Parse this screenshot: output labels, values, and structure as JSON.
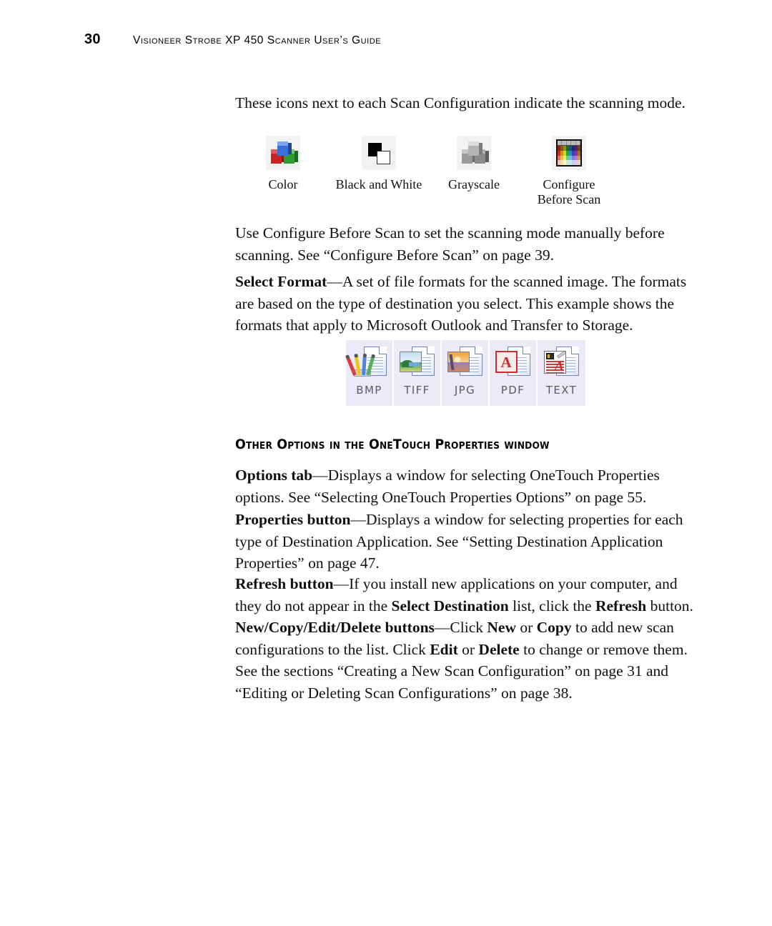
{
  "header": {
    "page_number": "30",
    "title": "Visioneer Strobe XP 450 Scanner User’s Guide"
  },
  "body": {
    "intro_paragraph": "These icons next to each Scan Configuration indicate the scanning mode.",
    "configure_paragraph": "Use Configure Before Scan to set the scanning mode manually before scanning. See “Configure Before Scan” on page 39."
  },
  "scan_modes": [
    {
      "icon": "color-cubes-icon",
      "label": "Color"
    },
    {
      "icon": "black-and-white-squares-icon",
      "label": "Black and White"
    },
    {
      "icon": "grayscale-cubes-icon",
      "label": "Grayscale"
    },
    {
      "icon": "color-palette-icon",
      "label": "Configure\nBefore Scan"
    }
  ],
  "select_format": {
    "bold_lead": "Select Format",
    "rest": "—A set of file formats for the scanned image. The formats are based on the type of destination you select. This example shows the formats that apply to Microsoft Outlook and Transfer to Storage."
  },
  "file_formats": [
    {
      "icon": "bmp-file-icon",
      "label": "BMP"
    },
    {
      "icon": "tiff-file-icon",
      "label": "TIFF"
    },
    {
      "icon": "jpg-file-icon",
      "label": "JPG"
    },
    {
      "icon": "pdf-file-icon",
      "label": "PDF"
    },
    {
      "icon": "text-file-icon",
      "label": "TEXT"
    }
  ],
  "section": {
    "heading": "Other Options in the OneTouch Properties window",
    "items": [
      {
        "bold_lead": "Options tab",
        "rest": "—Displays a window for selecting OneTouch Properties options. See “Selecting OneTouch Properties Options” on page 55."
      },
      {
        "bold_lead": "Properties button",
        "rest": "—Displays a window for selecting properties for each type of Destination Application. See “Setting Destination Application Properties” on page 47."
      },
      {
        "bold_lead": "Refresh button",
        "rest_a": "—If you install new applications on your computer, and they do not appear in the ",
        "bold_mid_a": "Select Destination",
        "rest_b": " list, click the ",
        "bold_mid_b": "Refresh",
        "rest_c": " button."
      },
      {
        "bold_lead": "New/Copy/Edit/Delete buttons",
        "rest_a": "—Click ",
        "bold_mid_a": "New",
        "rest_b": " or ",
        "bold_mid_b": "Copy",
        "rest_c": " to add new scan configurations to the list. Click ",
        "bold_mid_c": "Edit",
        "rest_d": " or ",
        "bold_mid_d": "Delete",
        "rest_e": " to change or remove them. See the sections “Creating a New Scan Configuration” on page 31 and “Editing or Deleting Scan Configurations” on page 38."
      }
    ]
  },
  "colors": {
    "page_background": "#ffffff",
    "text": "#111111",
    "format_tile_background": "#eceaf7",
    "format_label": "#5a5a6b",
    "mode_icon_background": "#f2f2f2"
  }
}
